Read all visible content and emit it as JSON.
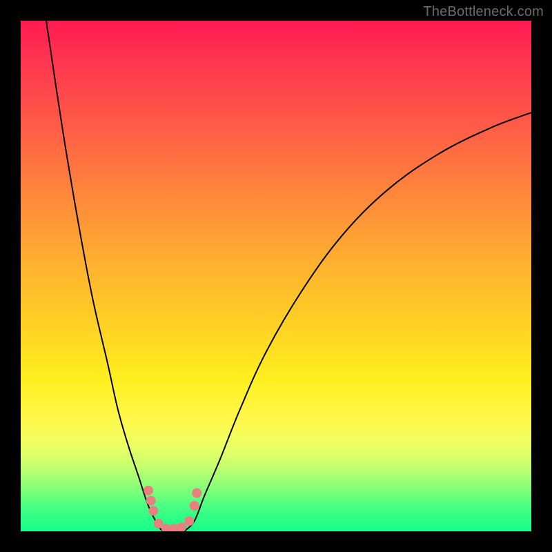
{
  "watermark": "TheBottleneck.com",
  "chart_data": {
    "type": "line",
    "title": "",
    "xlabel": "",
    "ylabel": "",
    "xlim": [
      0,
      100
    ],
    "ylim": [
      0,
      100
    ],
    "gradient_stops": [
      {
        "pct": 0,
        "color": "#ff1a52"
      },
      {
        "pct": 8,
        "color": "#ff3650"
      },
      {
        "pct": 20,
        "color": "#ff5a47"
      },
      {
        "pct": 35,
        "color": "#ff8a3a"
      },
      {
        "pct": 48,
        "color": "#ffb22f"
      },
      {
        "pct": 60,
        "color": "#ffd224"
      },
      {
        "pct": 70,
        "color": "#ffee1e"
      },
      {
        "pct": 78,
        "color": "#fff84a"
      },
      {
        "pct": 83,
        "color": "#eeff63"
      },
      {
        "pct": 87,
        "color": "#c8ff6d"
      },
      {
        "pct": 90,
        "color": "#9eff74"
      },
      {
        "pct": 93,
        "color": "#6dff7c"
      },
      {
        "pct": 96,
        "color": "#3dff84"
      },
      {
        "pct": 100,
        "color": "#15ff8a"
      }
    ],
    "series": [
      {
        "name": "left curve",
        "x": [
          5,
          8,
          11,
          14,
          17,
          19,
          21,
          23,
          25,
          27,
          28
        ],
        "y": [
          100,
          80,
          62,
          46,
          33,
          24,
          17,
          11,
          5,
          1,
          0
        ]
      },
      {
        "name": "right curve",
        "x": [
          32,
          34,
          36,
          39,
          43,
          48,
          55,
          63,
          72,
          82,
          92,
          100
        ],
        "y": [
          0,
          2,
          7,
          14,
          24,
          35,
          47,
          58,
          67,
          74,
          79,
          82
        ]
      }
    ],
    "markers": {
      "color": "#e88080",
      "points": [
        {
          "x": 25.0,
          "y": 8.0
        },
        {
          "x": 25.5,
          "y": 6.0
        },
        {
          "x": 26.0,
          "y": 4.0
        },
        {
          "x": 27.0,
          "y": 1.5
        },
        {
          "x": 28.5,
          "y": 0.5
        },
        {
          "x": 30.0,
          "y": 0.5
        },
        {
          "x": 31.5,
          "y": 0.8
        },
        {
          "x": 33.0,
          "y": 2.0
        },
        {
          "x": 34.0,
          "y": 5.0
        },
        {
          "x": 34.5,
          "y": 7.5
        }
      ]
    }
  }
}
